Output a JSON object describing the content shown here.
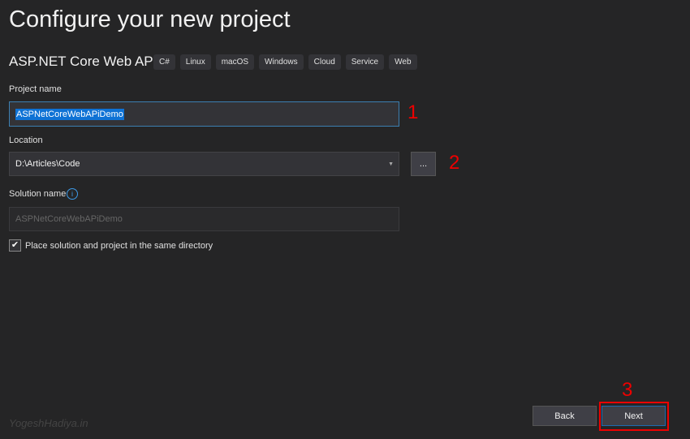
{
  "title": "Configure your new project",
  "template": {
    "name": "ASP.NET Core Web API",
    "tags": [
      "C#",
      "Linux",
      "macOS",
      "Windows",
      "Cloud",
      "Service",
      "Web"
    ]
  },
  "project_name": {
    "label": "Project name",
    "value": "ASPNetCoreWebAPiDemo"
  },
  "location": {
    "label": "Location",
    "value": "D:\\Articles\\Code",
    "browse_label": "..."
  },
  "solution_name": {
    "label": "Solution name",
    "placeholder": "ASPNetCoreWebAPiDemo"
  },
  "same_dir": {
    "label": "Place solution and project in the same directory",
    "checked": true
  },
  "annotations": [
    "1",
    "2",
    "3"
  ],
  "buttons": {
    "back": "Back",
    "next": "Next"
  },
  "watermark": "YogeshHadiya.in",
  "colors": {
    "accent": "#0e72d5",
    "annotation": "#e00000"
  }
}
